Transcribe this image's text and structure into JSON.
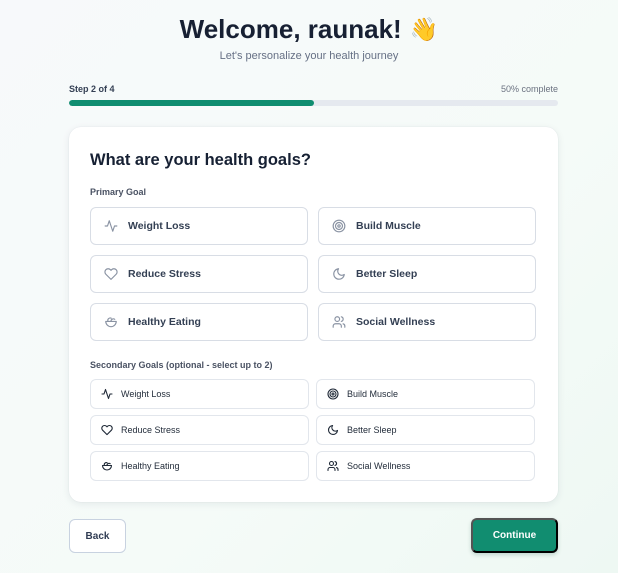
{
  "header": {
    "title": "Welcome, raunak!",
    "wave_emoji": "👋",
    "subtitle": "Let's personalize your health journey"
  },
  "progress": {
    "step_label": "Step 2 of 4",
    "percent_label": "50% complete",
    "fraction": 0.5,
    "color": "#0f8d70"
  },
  "card": {
    "title": "What are your health goals?",
    "primary_label": "Primary Goal",
    "secondary_label": "Secondary Goals (optional - select up to 2)",
    "primary_goals": [
      {
        "label": "Weight Loss",
        "icon": "activity-icon"
      },
      {
        "label": "Build Muscle",
        "icon": "target-icon"
      },
      {
        "label": "Reduce Stress",
        "icon": "heart-icon"
      },
      {
        "label": "Better Sleep",
        "icon": "moon-icon"
      },
      {
        "label": "Healthy Eating",
        "icon": "salad-icon"
      },
      {
        "label": "Social Wellness",
        "icon": "users-icon"
      }
    ],
    "secondary_goals": [
      {
        "label": "Weight Loss",
        "icon": "activity-icon"
      },
      {
        "label": "Build Muscle",
        "icon": "target-icon"
      },
      {
        "label": "Reduce Stress",
        "icon": "heart-icon"
      },
      {
        "label": "Better Sleep",
        "icon": "moon-icon"
      },
      {
        "label": "Healthy Eating",
        "icon": "salad-icon"
      },
      {
        "label": "Social Wellness",
        "icon": "users-icon"
      }
    ]
  },
  "footer": {
    "back_label": "Back",
    "continue_label": "Continue",
    "accent_color": "#118d70"
  }
}
